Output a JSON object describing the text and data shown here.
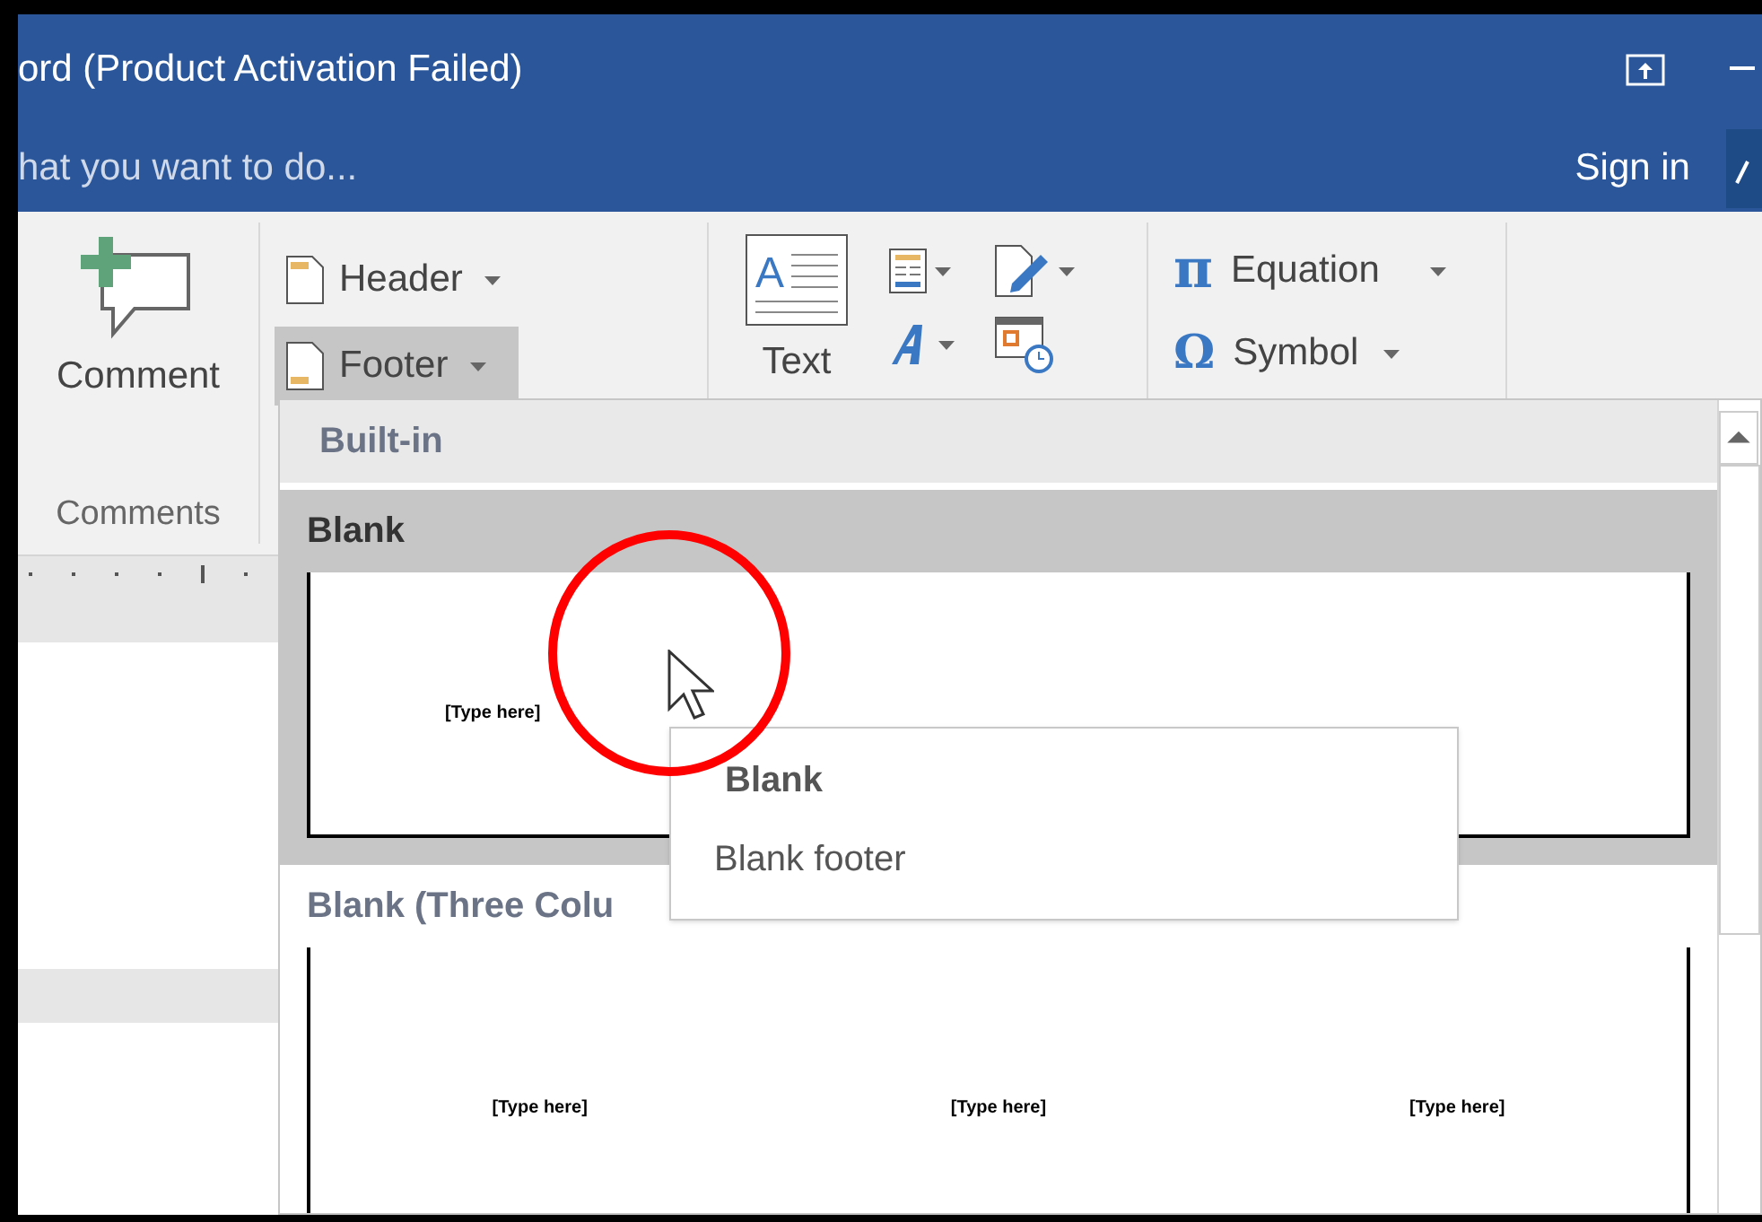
{
  "window": {
    "title": "ord (Product Activation Failed)",
    "tell_me": "hat you want to do...",
    "sign_in": "Sign in"
  },
  "ribbon": {
    "comments": {
      "button": "Comment",
      "group_label": "Comments"
    },
    "header_footer": [
      {
        "label": "Header",
        "selected": false
      },
      {
        "label": "Footer",
        "selected": true
      }
    ],
    "text_group": {
      "label": "Text",
      "icon_letter": "A"
    },
    "symbols": [
      {
        "kind": "equation",
        "glyph": "π",
        "label": "Equation"
      },
      {
        "kind": "symbol",
        "glyph": "Ω",
        "label": "Symbol"
      }
    ]
  },
  "gallery": {
    "section": "Built-in",
    "items": [
      {
        "title": "Blank",
        "selected": true,
        "placeholders": [
          "[Type here]"
        ]
      },
      {
        "title": "Blank (Three Colu",
        "selected": false,
        "placeholders": [
          "[Type here]",
          "[Type here]",
          "[Type here]"
        ]
      }
    ]
  },
  "tooltip": {
    "title": "Blank",
    "description": "Blank footer"
  }
}
